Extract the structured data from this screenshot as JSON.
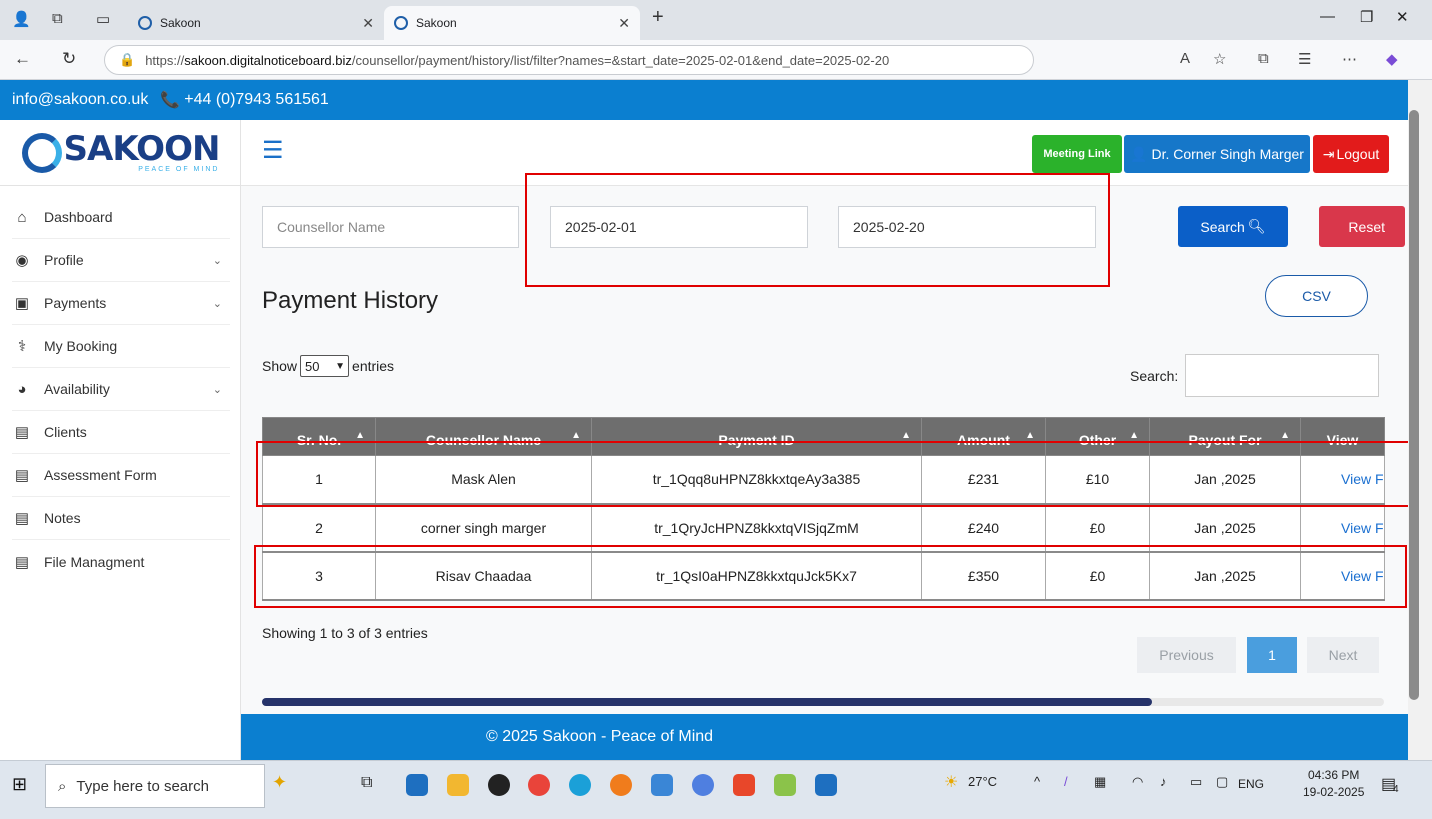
{
  "browser": {
    "tabs": [
      {
        "title": "Sakoon",
        "active": false
      },
      {
        "title": "Sakoon",
        "active": true
      }
    ],
    "url_prefix": "https://",
    "url_host": "sakoon.digitalnoticeboard.biz",
    "url_path": "/counsellor/payment/history/list/filter?names=&start_date=2025-02-01&end_date=2025-02-20"
  },
  "site": {
    "email": "info@sakoon.co.uk",
    "phone": "+44 (0)7943 561561",
    "logo_text": "SAKOON",
    "logo_tagline": "PEACE OF MIND",
    "meeting_link": "Meeting Link",
    "user_name": "Dr. Corner Singh Marger",
    "logout": "Logout",
    "footer": "© 2025 Sakoon - Peace of Mind"
  },
  "sidebar": {
    "items": [
      {
        "label": "Dashboard",
        "icon": "home-icon",
        "has_submenu": false
      },
      {
        "label": "Profile",
        "icon": "user-circle-icon",
        "has_submenu": true
      },
      {
        "label": "Payments",
        "icon": "money-icon",
        "has_submenu": true
      },
      {
        "label": "My Booking",
        "icon": "stethoscope-icon",
        "has_submenu": false
      },
      {
        "label": "Availability",
        "icon": "dashboard-gauge-icon",
        "has_submenu": true
      },
      {
        "label": "Clients",
        "icon": "document-icon",
        "has_submenu": false
      },
      {
        "label": "Assessment Form",
        "icon": "document-icon",
        "has_submenu": false
      },
      {
        "label": "Notes",
        "icon": "document-icon",
        "has_submenu": false
      },
      {
        "label": "File Managment",
        "icon": "document-icon",
        "has_submenu": false
      }
    ]
  },
  "filters": {
    "counsellor_placeholder": "Counsellor Name",
    "start_date": "2025-02-01",
    "end_date": "2025-02-20",
    "search_label": "Search",
    "reset_label": "Reset"
  },
  "page": {
    "title": "Payment History",
    "csv_label": "CSV",
    "show_label": "Show",
    "entries_value": "50",
    "entries_label": "entries",
    "search_label": "Search:",
    "info": "Showing 1 to 3 of 3 entries",
    "prev": "Previous",
    "current_page": "1",
    "next": "Next"
  },
  "table": {
    "headers": [
      "Sr. No.",
      "Counsellor Name",
      "Payment ID",
      "Amount",
      "Other",
      "Payout For",
      "View"
    ],
    "rows": [
      [
        "1",
        "Mask Alen",
        "tr_1Qqq8uHPNZ8kkxtqeAy3a385",
        "£231",
        "£10",
        "Jan ,2025",
        "View F"
      ],
      [
        "2",
        "corner singh marger",
        "tr_1QryJcHPNZ8kkxtqVISjqZmM",
        "£240",
        "£0",
        "Jan ,2025",
        "View F"
      ],
      [
        "3",
        "Risav Chaadaa",
        "tr_1QsI0aHPNZ8kkxtquJck5Kx7",
        "£350",
        "£0",
        "Jan ,2025",
        "View F"
      ]
    ]
  },
  "taskbar": {
    "search_placeholder": "Type here to search",
    "temperature": "27°C",
    "language": "ENG",
    "time": "04:36 PM",
    "date": "19-02-2025",
    "notifications": "4"
  },
  "colors": {
    "brand_blue": "#0b7fd0",
    "search_button": "#0b5fc8",
    "reset_button": "#d9374b",
    "meeting_button": "#2bb22b",
    "logout_button": "#e21b1b",
    "highlight_box": "#e00000"
  }
}
